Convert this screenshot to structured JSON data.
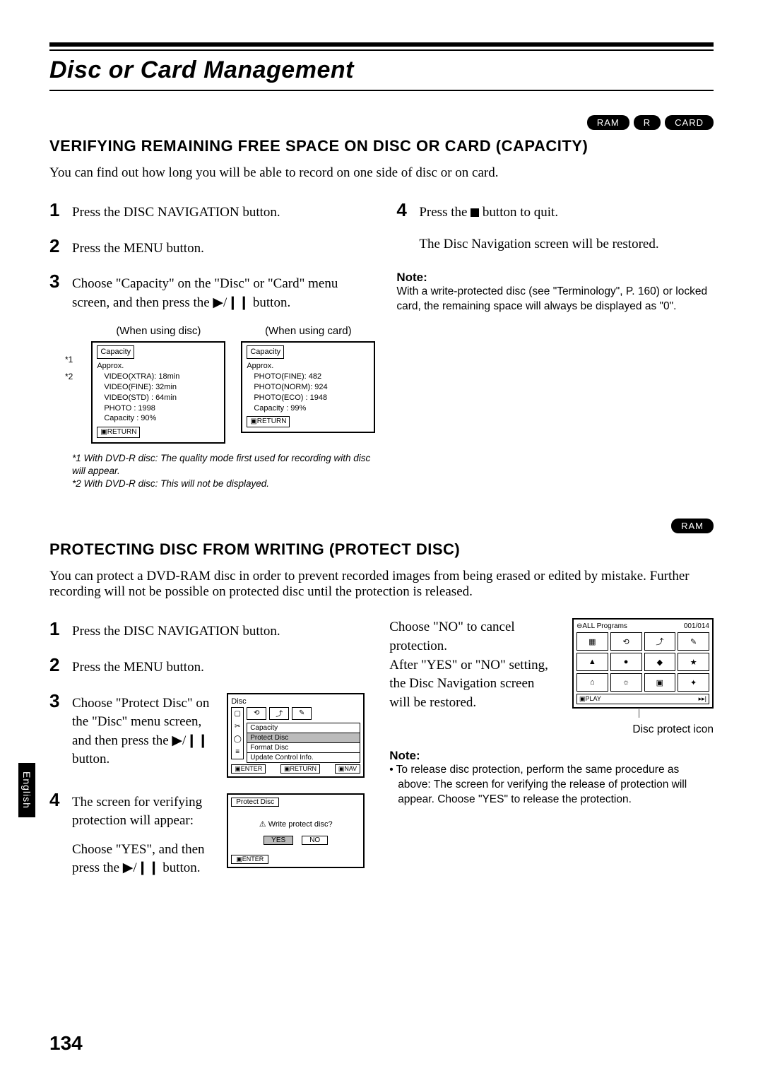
{
  "page": {
    "title": "Disc or Card Management",
    "number": "134",
    "side_tab": "English"
  },
  "badges": {
    "ram": "RAM",
    "r": "R",
    "card": "CARD"
  },
  "section1": {
    "heading": "VERIFYING REMAINING FREE SPACE ON DISC OR CARD (CAPACITY)",
    "intro": "You can find out how long you will be able to record on one side of disc or on card.",
    "steps": {
      "s1": "Press the DISC NAVIGATION button.",
      "s2": "Press the MENU button.",
      "s3": "Choose \"Capacity\" on the \"Disc\" or \"Card\" menu screen, and then press the ▶/❙❙ button.",
      "s4_a": "Press the ",
      "s4_b": " button to quit.",
      "restored": "The Disc Navigation screen will be restored."
    },
    "note_h": "Note:",
    "note_b": "With a write-protected disc (see \"Terminology\", P. 160) or locked card, the remaining space will always be displayed as \"0\".",
    "diag_label_disc": "(When using disc)",
    "diag_label_card": "(When using card)",
    "disc_diag": {
      "title": "Capacity",
      "approx": "Approx.",
      "l1": "VIDEO(XTRA): 18min",
      "l2": "VIDEO(FINE): 32min",
      "l3": "VIDEO(STD) : 64min",
      "l4": "PHOTO      : 1998",
      "l5": "Capacity   : 90%",
      "ret": "▣RETURN"
    },
    "card_diag": {
      "title": "Capacity",
      "approx": "Approx.",
      "l1": "PHOTO(FINE): 482",
      "l2": "PHOTO(NORM): 924",
      "l3": "PHOTO(ECO) : 1948",
      "l4": "Capacity   : 99%",
      "ret": "▣RETURN"
    },
    "markers": {
      "m1": "*1",
      "m2": "*2"
    },
    "footnotes": {
      "f1": "*1  With DVD-R disc: The quality mode first used for recording with disc will appear.",
      "f2": "*2  With DVD-R disc: This will not be displayed."
    }
  },
  "section2": {
    "heading": "PROTECTING DISC FROM WRITING (PROTECT DISC)",
    "intro": "You can protect a DVD-RAM disc in order to prevent recorded images from being erased or edited by mistake. Further recording will not be possible on protected disc until the protection is released.",
    "steps": {
      "s1": "Press the DISC NAVIGATION button.",
      "s2": "Press the MENU button.",
      "s3": "Choose \"Protect Disc\" on the \"Disc\" menu screen, and then press the ▶/❙❙ button.",
      "s4a": "The screen for verifying protection will appear:",
      "s4b": "Choose \"YES\", and then press the ▶/❙❙ button."
    },
    "rcol": {
      "para": "Choose \"NO\" to cancel protection.\nAfter \"YES\" or \"NO\" setting, the Disc Navigation screen will be restored.",
      "note_h": "Note:",
      "note_b": "To release disc protection, perform the same procedure as above: The screen for verifying the release of protection will appear. Choose \"YES\" to release the protection.",
      "thumb_caption": "Disc protect icon"
    },
    "menu_diag": {
      "title": "Disc",
      "items": {
        "i1": "Capacity",
        "i2": "Protect Disc",
        "i3": "Format Disc",
        "i4": "Update Control Info."
      },
      "b1": "▣ENTER",
      "b2": "▣RETURN",
      "b3": "▣NAV"
    },
    "protect_diag": {
      "title": "Protect Disc",
      "question": "⚠ Write protect disc?",
      "yes": "YES",
      "no": "NO",
      "enter": "▣ENTER"
    },
    "thumb_diag": {
      "h1": "⊖ALL  Programs",
      "h2": "001/014",
      "bot1": "▣PLAY",
      "bot2": "▸▸|"
    }
  }
}
